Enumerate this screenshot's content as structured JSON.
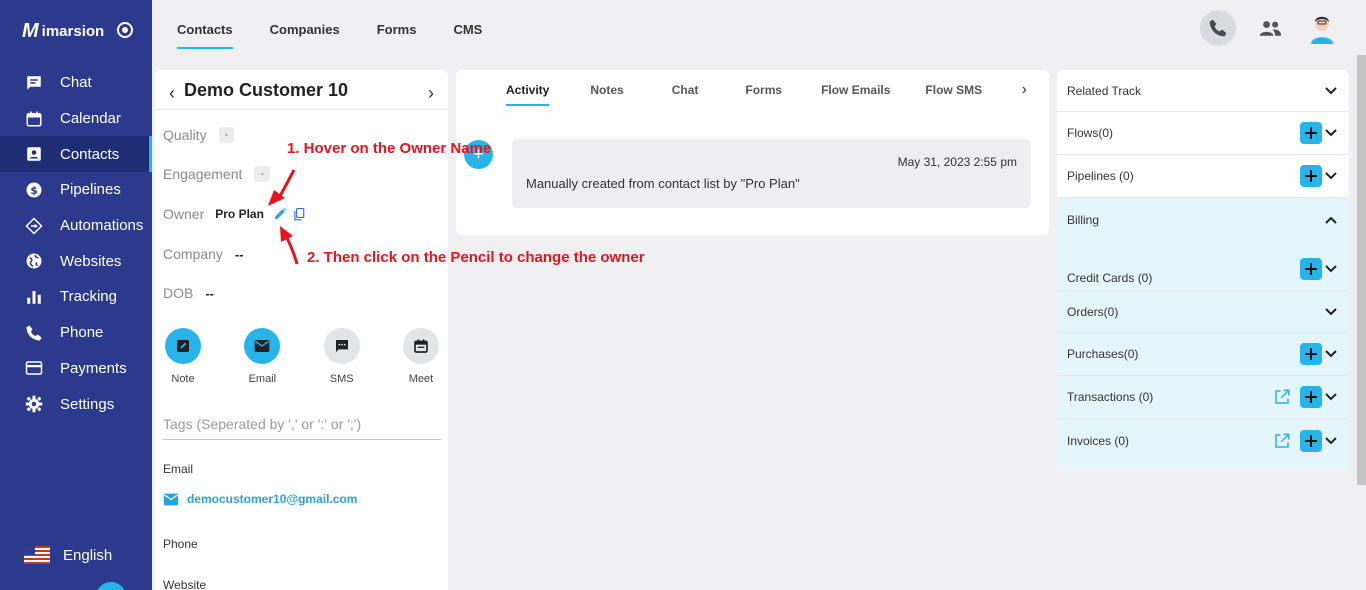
{
  "brand": {
    "mark": "M",
    "name": "imarsion"
  },
  "sidebar": {
    "items": [
      {
        "label": "Chat",
        "icon": "chat-icon"
      },
      {
        "label": "Calendar",
        "icon": "calendar-icon"
      },
      {
        "label": "Contacts",
        "icon": "contacts-icon",
        "active": true
      },
      {
        "label": "Pipelines",
        "icon": "pipelines-icon"
      },
      {
        "label": "Automations",
        "icon": "automations-icon"
      },
      {
        "label": "Websites",
        "icon": "websites-icon"
      },
      {
        "label": "Tracking",
        "icon": "tracking-icon"
      },
      {
        "label": "Phone",
        "icon": "phone-icon"
      },
      {
        "label": "Payments",
        "icon": "payments-icon"
      },
      {
        "label": "Settings",
        "icon": "settings-icon"
      }
    ],
    "language": "English"
  },
  "top_tabs": [
    "Contacts",
    "Companies",
    "Forms",
    "CMS"
  ],
  "contact": {
    "name": "Demo Customer 10",
    "quality_label": "Quality",
    "quality_value": "-",
    "engagement_label": "Engagement",
    "engagement_value": "-",
    "owner_label": "Owner",
    "owner_value": "Pro Plan",
    "company_label": "Company",
    "company_value": "--",
    "dob_label": "DOB",
    "dob_value": "--",
    "actions": [
      "Note",
      "Email",
      "SMS",
      "Meet"
    ],
    "tags_placeholder": "Tags (Seperated by ',' or ':' or ';')",
    "email_label": "Email",
    "email_value": "democustomer10@gmail.com",
    "phone_label": "Phone",
    "website_label": "Website"
  },
  "activity": {
    "tabs": [
      "Activity",
      "Notes",
      "Chat",
      "Forms",
      "Flow Emails",
      "Flow SMS"
    ],
    "entry_date": "May 31, 2023 2:55 pm",
    "entry_text": "Manually created from contact list by \"Pro Plan\""
  },
  "related": {
    "rows": [
      {
        "label": "Related Track"
      },
      {
        "label": "Flows(0)"
      },
      {
        "label": "Pipelines (0)"
      },
      {
        "label": "Billing"
      },
      {
        "label": "Credit Cards (0)"
      },
      {
        "label": "Orders(0)"
      },
      {
        "label": "Purchases(0)"
      },
      {
        "label": "Transactions (0)"
      },
      {
        "label": "Invoices (0)"
      }
    ]
  },
  "annotations": {
    "step1": "1. Hover on the Owner Name",
    "step2": "2. Then click on the Pencil to change the owner"
  },
  "colors": {
    "sidebar": "#2b3a8c",
    "accent": "#26b4ea",
    "annotation": "#e6141b"
  }
}
